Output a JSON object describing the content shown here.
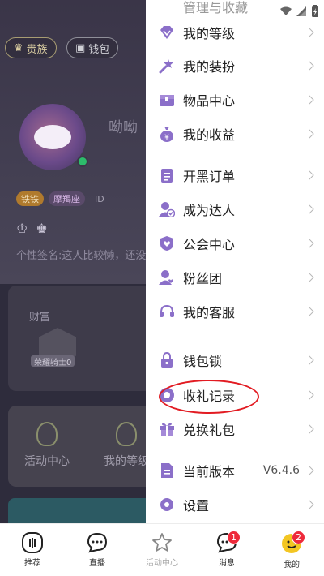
{
  "background_page": {
    "noble_pill": "贵族",
    "wallet_pill": "钱包",
    "nickname": "呦呦",
    "tags": {
      "gold": "铁铁",
      "zodiac": "摩羯座",
      "id": "ID"
    },
    "signature": "个性签名:这人比较懒，还没",
    "wealth_card": {
      "title": "财富",
      "badge_label": "荣耀骑士0"
    },
    "features": [
      {
        "label": "活动中心"
      },
      {
        "label": "我的等级"
      }
    ]
  },
  "drawer": {
    "menu": [
      {
        "label": "我的等级",
        "icon": "diamond-icon"
      },
      {
        "label": "我的装扮",
        "icon": "wand-icon"
      },
      {
        "label": "物品中心",
        "icon": "box-icon"
      },
      {
        "label": "我的收益",
        "icon": "money-bag-icon"
      },
      {
        "label": "开黑订单",
        "icon": "clipboard-icon"
      },
      {
        "label": "成为达人",
        "icon": "user-check-icon"
      },
      {
        "label": "公会中心",
        "icon": "shield-heart-icon"
      },
      {
        "label": "粉丝团",
        "icon": "fans-icon"
      },
      {
        "label": "我的客服",
        "icon": "headset-icon"
      },
      {
        "label": "钱包锁",
        "icon": "lock-icon"
      },
      {
        "label": "收礼记录",
        "icon": "gift-record-icon"
      },
      {
        "label": "兑换礼包",
        "icon": "gift-icon"
      },
      {
        "label": "当前版本",
        "icon": "file-icon",
        "value": "V6.4.6"
      },
      {
        "label": "设置",
        "icon": "gear-icon"
      }
    ]
  },
  "tabbar": {
    "tabs": [
      {
        "label": "推荐",
        "icon": "recommend-icon"
      },
      {
        "label": "直播",
        "icon": "chat-icon"
      },
      {
        "label": "活动中心",
        "icon": "star-icon"
      },
      {
        "label": "消息",
        "icon": "message-icon",
        "badge": "1"
      },
      {
        "label": "我的",
        "icon": "profile-icon",
        "badge": "2"
      }
    ]
  },
  "colors": {
    "accent": "#8b6fc9",
    "badge_red": "#ee2a3b",
    "annotation_red": "#e21b22"
  }
}
